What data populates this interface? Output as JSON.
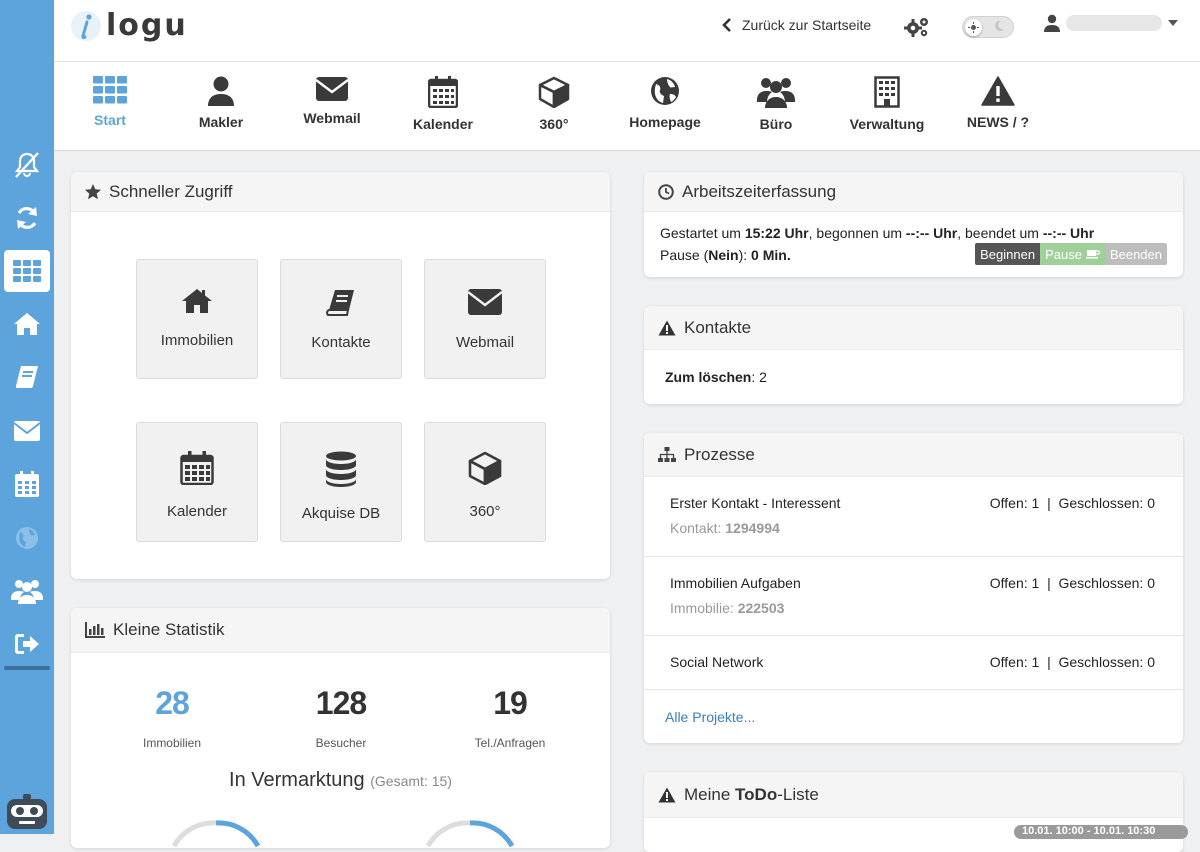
{
  "header": {
    "logo_text": "logu",
    "back_label": "Zurück zur Startseite"
  },
  "nav": [
    {
      "label": "Start",
      "icon": "grid-icon",
      "active": true
    },
    {
      "label": "Makler",
      "icon": "user-icon"
    },
    {
      "label": "Webmail",
      "icon": "envelope-icon"
    },
    {
      "label": "Kalender",
      "icon": "calendar-icon"
    },
    {
      "label": "360°",
      "icon": "cube-icon"
    },
    {
      "label": "Homepage",
      "icon": "globe-icon"
    },
    {
      "label": "Büro",
      "icon": "users-icon"
    },
    {
      "label": "Verwaltung",
      "icon": "building-icon"
    },
    {
      "label": "NEWS / ?",
      "icon": "warning-icon"
    }
  ],
  "sidebar": [
    "bell-slash-icon",
    "refresh-icon",
    "grid-icon",
    "home-icon",
    "book-icon",
    "envelope-icon",
    "calendar-icon",
    "globe-icon",
    "users-icon",
    "sign-out-icon"
  ],
  "quick": {
    "title": "Schneller Zugriff",
    "tiles": [
      "Immobilien",
      "Kontakte",
      "Webmail",
      "Kalender",
      "Akquise DB",
      "360°"
    ]
  },
  "stats": {
    "title": "Kleine Statistik",
    "items": [
      {
        "value": "28",
        "label": "Immobilien"
      },
      {
        "value": "128",
        "label": "Besucher"
      },
      {
        "value": "19",
        "label": "Tel./Anfragen"
      }
    ],
    "vermarktung": "In Vermarktung",
    "gesamt": "(Gesamt: 15)"
  },
  "arbeitszeit": {
    "title": "Arbeitszeiterfassung",
    "p1": "Gestartet um ",
    "t1": "15:22 Uhr",
    "p2": ", begonnen um ",
    "t2": "--:-- Uhr",
    "p3": ", beendet um ",
    "t3": "--:-- Uhr",
    "pause_a": "Pause (",
    "pause_b": "Nein",
    "pause_c": "): ",
    "pause_d": "0 Min.",
    "btn_begin": "Beginnen",
    "btn_pause": "Pause",
    "btn_end": "Beenden"
  },
  "kontakte": {
    "title": "Kontakte",
    "label": "Zum löschen",
    "value": ": 2"
  },
  "prozesse": {
    "title": "Prozesse",
    "rows": [
      {
        "name": "Erster Kontakt - Interessent",
        "meta_label": "Kontakt: ",
        "meta_value": "1294994",
        "counts": "Offen: 1  |  Geschlossen: 0"
      },
      {
        "name": "Immobilien Aufgaben",
        "meta_label": "Immobilie: ",
        "meta_value": "222503",
        "counts": "Offen: 1  |  Geschlossen: 0"
      },
      {
        "name": "Social Network",
        "meta_label": "",
        "meta_value": "",
        "counts": "Offen: 1  |  Geschlossen: 0"
      }
    ],
    "all_link": "Alle Projekte..."
  },
  "todo": {
    "title_a": "Meine ",
    "title_b": "ToDo",
    "title_c": "-Liste",
    "date": "10.01. 10:00 - 10.01. 10:30"
  },
  "colors": {
    "accent": "#5ea4dc",
    "sidebar": "#5ea4dc",
    "begin": "#555555",
    "pause": "#9fd09a",
    "end": "#bdbdbd"
  }
}
